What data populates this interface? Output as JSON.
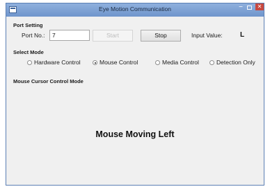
{
  "window": {
    "title": "Eye Motion Communication",
    "minimize_symbol": "−",
    "close_symbol": "✕"
  },
  "port_setting": {
    "title": "Port Setting",
    "port_label": "Port No.:",
    "port_value": "7",
    "start_label": "Start",
    "stop_label": "Stop",
    "input_value_label": "Input Value:",
    "input_value": "L"
  },
  "select_mode": {
    "title": "Select Mode",
    "options": [
      {
        "label": "Hardware Control",
        "checked": false
      },
      {
        "label": "Mouse Control",
        "checked": true
      },
      {
        "label": "Media Control",
        "checked": false
      },
      {
        "label": "Detection Only",
        "checked": false
      }
    ]
  },
  "mode_panel": {
    "title": "Mouse Cursor Control Mode",
    "status": "Mouse Moving Left"
  }
}
